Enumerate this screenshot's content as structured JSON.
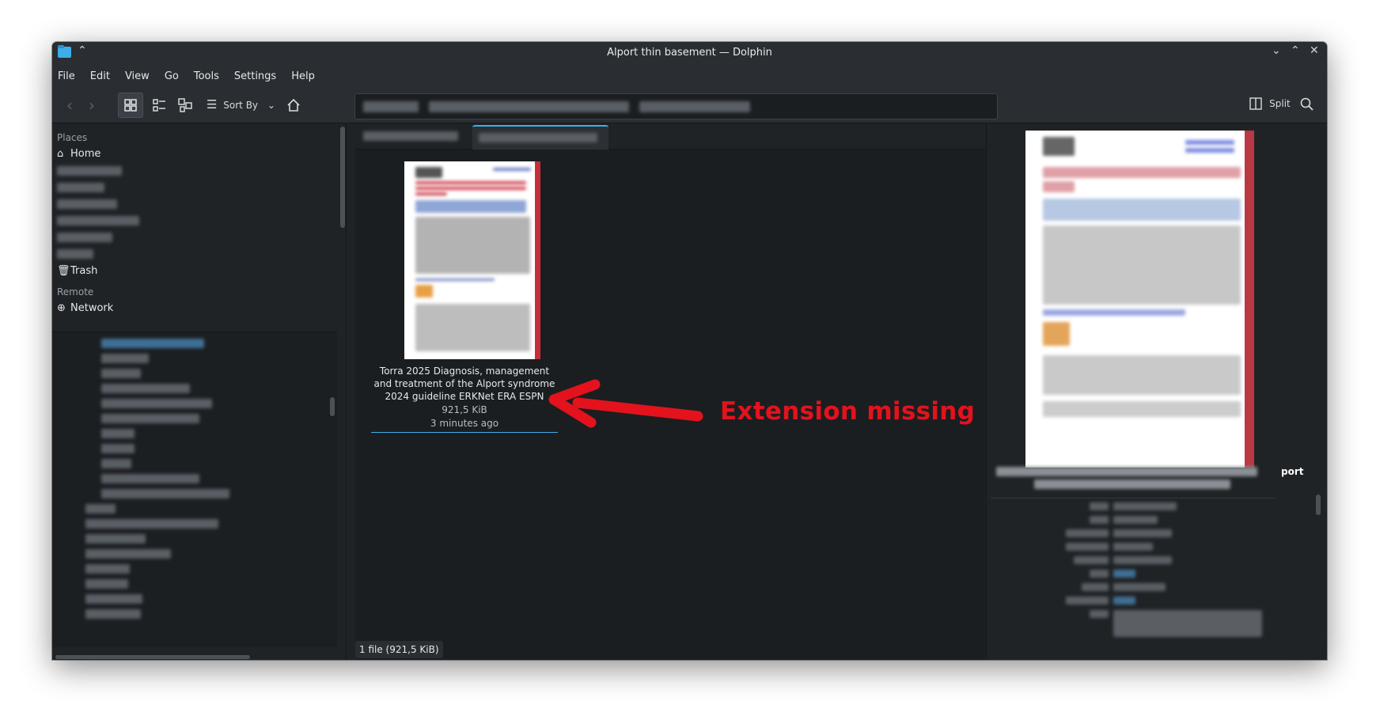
{
  "window": {
    "title": "Alport thin basement — Dolphin",
    "controls": {
      "minimize": "⌄",
      "maximize": "⌃",
      "close": "✕"
    }
  },
  "menu": [
    "File",
    "Edit",
    "View",
    "Go",
    "Tools",
    "Settings",
    "Help"
  ],
  "toolbar": {
    "sort_label": "Sort By",
    "split_label": "Split"
  },
  "sidebar": {
    "places_label": "Places",
    "home_label": "Home",
    "trash_label": "Trash",
    "remote_label": "Remote",
    "network_label": "Network"
  },
  "file": {
    "name": "Torra 2025 Diagnosis, management and treatment of the Alport syndrome 2024 guideline ERKNet ERA ESPN",
    "size": "921,5 KiB",
    "modified": "3 minutes ago"
  },
  "statusbar": {
    "text": "1 file (921,5 KiB)"
  },
  "info_panel": {
    "visible_fragment": "port"
  },
  "annotation": {
    "text": "Extension missing",
    "color": "#e3121d"
  },
  "colors": {
    "accent": "#3daee9",
    "window_bg": "#202326",
    "view_bg": "#1b1e20"
  },
  "icons": [
    "dolphin-folder-icon",
    "keep-above-icon",
    "back-icon",
    "forward-icon",
    "icons-view-icon",
    "details-view-icon",
    "compact-view-icon",
    "sort-icon",
    "home-icon",
    "split-icon",
    "search-icon",
    "trash-icon",
    "network-icon"
  ]
}
